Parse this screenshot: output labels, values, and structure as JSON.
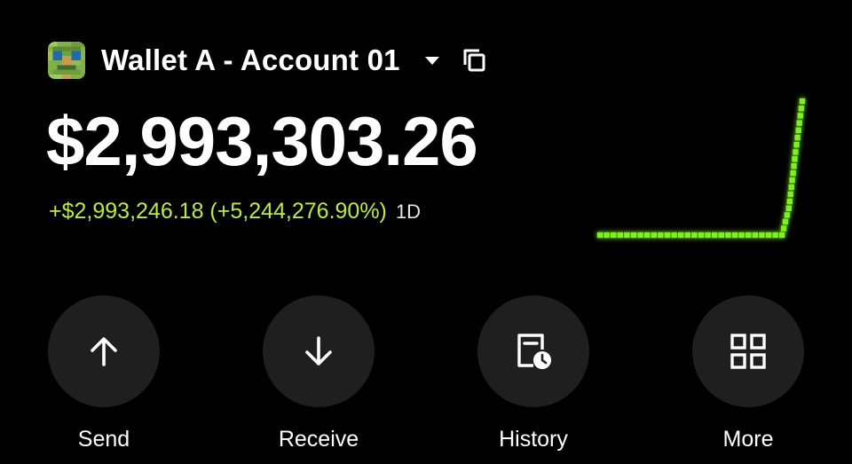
{
  "account": {
    "name": "Wallet A - Account 01",
    "avatar_icon": "pixel-art-avatar-icon",
    "dropdown_icon": "caret-down-icon",
    "copy_icon": "copy-icon"
  },
  "balance": {
    "value": "$2,993,303.26",
    "change": "+$2,993,246.18 (+5,244,276.90%)",
    "period": "1D",
    "change_color": "#b9ea4a"
  },
  "sparkline": {
    "color": "#7ef020",
    "x": [
      0,
      1,
      2,
      3,
      4,
      5,
      6,
      7,
      8,
      9,
      10,
      11,
      12,
      13,
      14,
      15,
      16,
      17,
      18,
      19,
      20,
      21,
      22,
      23,
      24,
      25,
      26,
      27,
      28,
      29,
      30
    ],
    "y": [
      0,
      0,
      0,
      0,
      0,
      0,
      0,
      0,
      0,
      0,
      0,
      0,
      0,
      0,
      0,
      0,
      0,
      0,
      0,
      0,
      0,
      0,
      0,
      0,
      0,
      0,
      0,
      0,
      0.2,
      0.62,
      1
    ]
  },
  "actions": [
    {
      "label": "Send",
      "icon": "arrow-up-icon"
    },
    {
      "label": "Receive",
      "icon": "arrow-down-icon"
    },
    {
      "label": "History",
      "icon": "history-receipt-clock-icon"
    },
    {
      "label": "More",
      "icon": "grid-icon"
    }
  ],
  "colors": {
    "background": "#000000",
    "button_bg": "#1f1f1f",
    "accent_green": "#b9ea4a"
  }
}
